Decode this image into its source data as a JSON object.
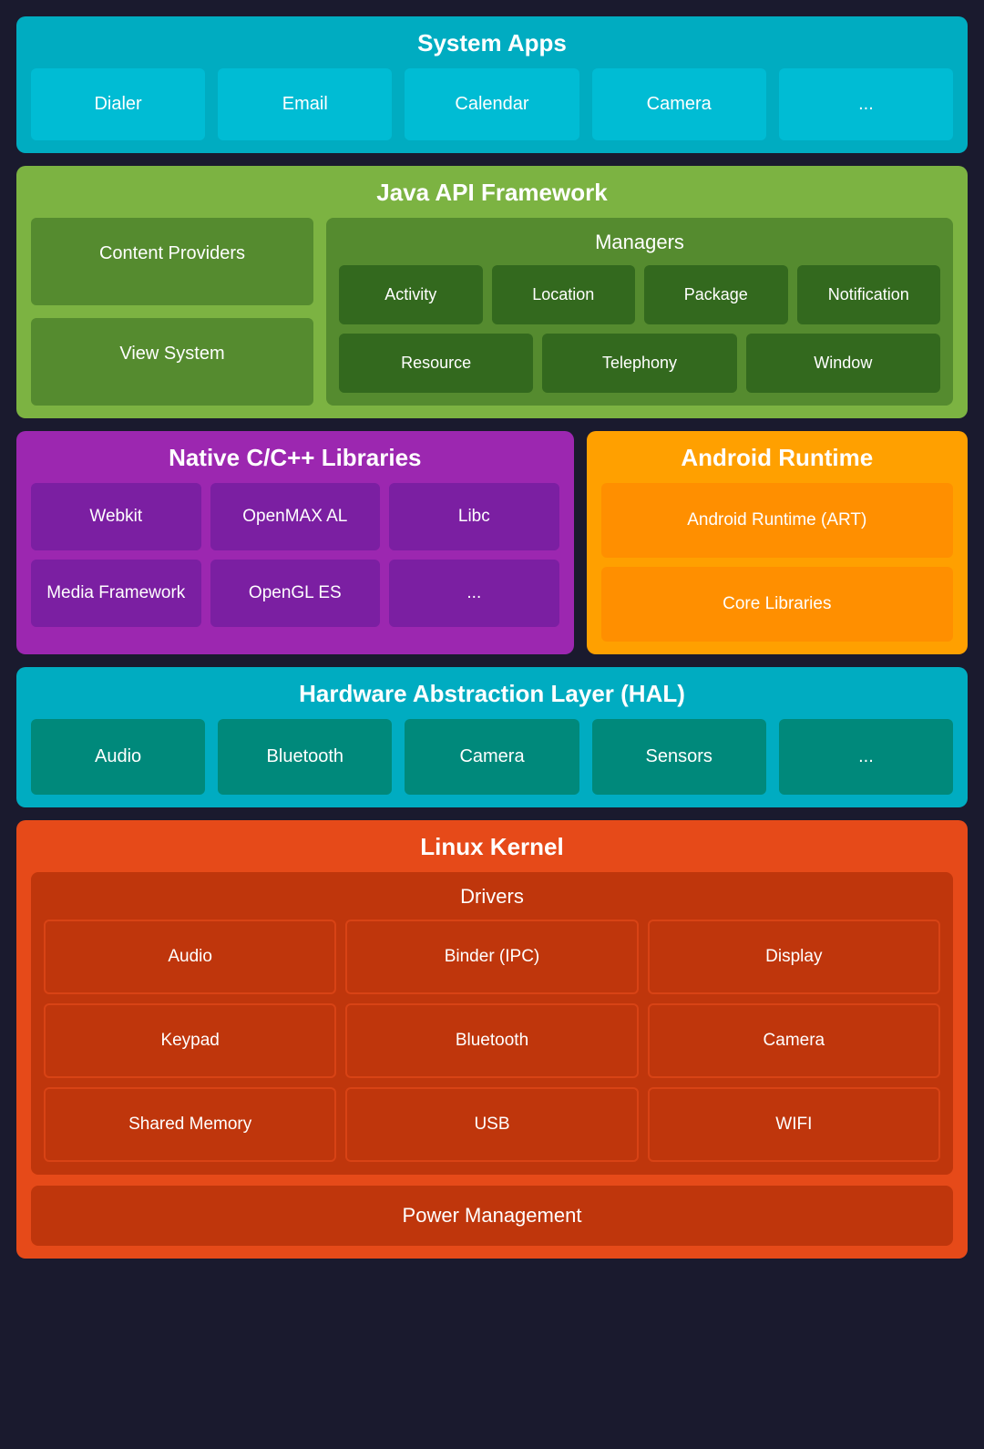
{
  "system_apps": {
    "title": "System Apps",
    "items": [
      "Dialer",
      "Email",
      "Calendar",
      "Camera",
      "..."
    ]
  },
  "java_api": {
    "title": "Java API Framework",
    "left_items": [
      "Content Providers",
      "View System"
    ],
    "managers_title": "Managers",
    "managers_row1": [
      "Activity",
      "Location",
      "Package",
      "Notification"
    ],
    "managers_row2": [
      "Resource",
      "Telephony",
      "Window"
    ]
  },
  "native_libs": {
    "title": "Native C/C++ Libraries",
    "row1": [
      "Webkit",
      "OpenMAX AL",
      "Libc"
    ],
    "row2": [
      "Media Framework",
      "OpenGL ES",
      "..."
    ]
  },
  "android_runtime": {
    "title": "Android Runtime",
    "items": [
      "Android Runtime (ART)",
      "Core Libraries"
    ]
  },
  "hal": {
    "title": "Hardware Abstraction Layer (HAL)",
    "items": [
      "Audio",
      "Bluetooth",
      "Camera",
      "Sensors",
      "..."
    ]
  },
  "linux_kernel": {
    "title": "Linux Kernel",
    "drivers_title": "Drivers",
    "drivers_row1": [
      "Audio",
      "Binder (IPC)",
      "Display"
    ],
    "drivers_row2": [
      "Keypad",
      "Bluetooth",
      "Camera"
    ],
    "drivers_row3": [
      "Shared Memory",
      "USB",
      "WIFI"
    ],
    "power_management": "Power Management"
  }
}
